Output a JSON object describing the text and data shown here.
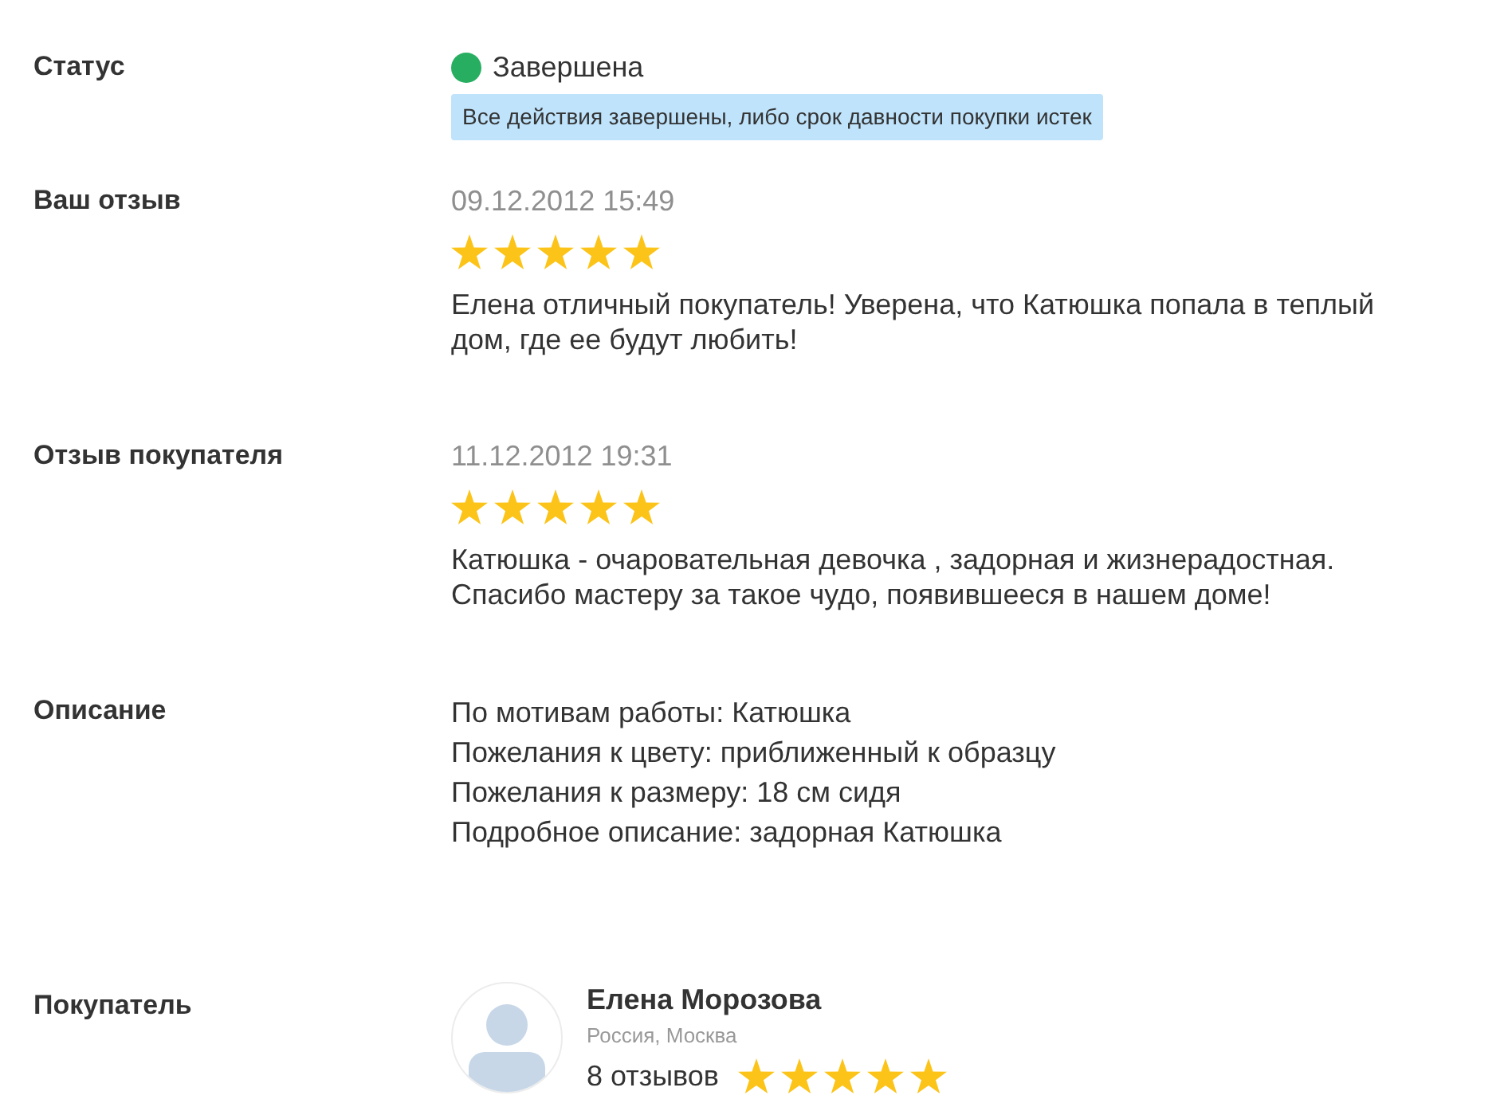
{
  "rows": [
    {
      "kind": "status",
      "label": "Статус",
      "status": {
        "text": "Завершена",
        "color": "#27ae60"
      },
      "hint": "Все действия завершены, либо срок давности покупки истек"
    },
    {
      "kind": "review",
      "label": "Ваш отзыв",
      "date": "09.12.2012 15:49",
      "stars": 5,
      "text": "Елена отличный покупатель! Уверена, что Катюшка попала в теплый дом, где ее будут любить!"
    },
    {
      "kind": "review",
      "label": "Отзыв покупателя",
      "date": "11.12.2012 19:31",
      "stars": 5,
      "text": "Катюшка - очаровательная девочка , задорная и жизнерадостная. Спасибо мастеру за такое чудо, появившееся в нашем доме!"
    },
    {
      "kind": "description",
      "label": "Описание",
      "lines": [
        "По мотивам работы: Катюшка",
        "Пожелания к цвету: приближенный к образцу",
        "Пожелания к размеру: 18 см сидя",
        "Подробное описание: задорная Катюшка"
      ]
    },
    {
      "kind": "buyer",
      "label": "Покупатель",
      "name": "Елена Морозова",
      "location": "Россия, Москва",
      "reviews": "8 отзывов",
      "stars": 5
    }
  ]
}
